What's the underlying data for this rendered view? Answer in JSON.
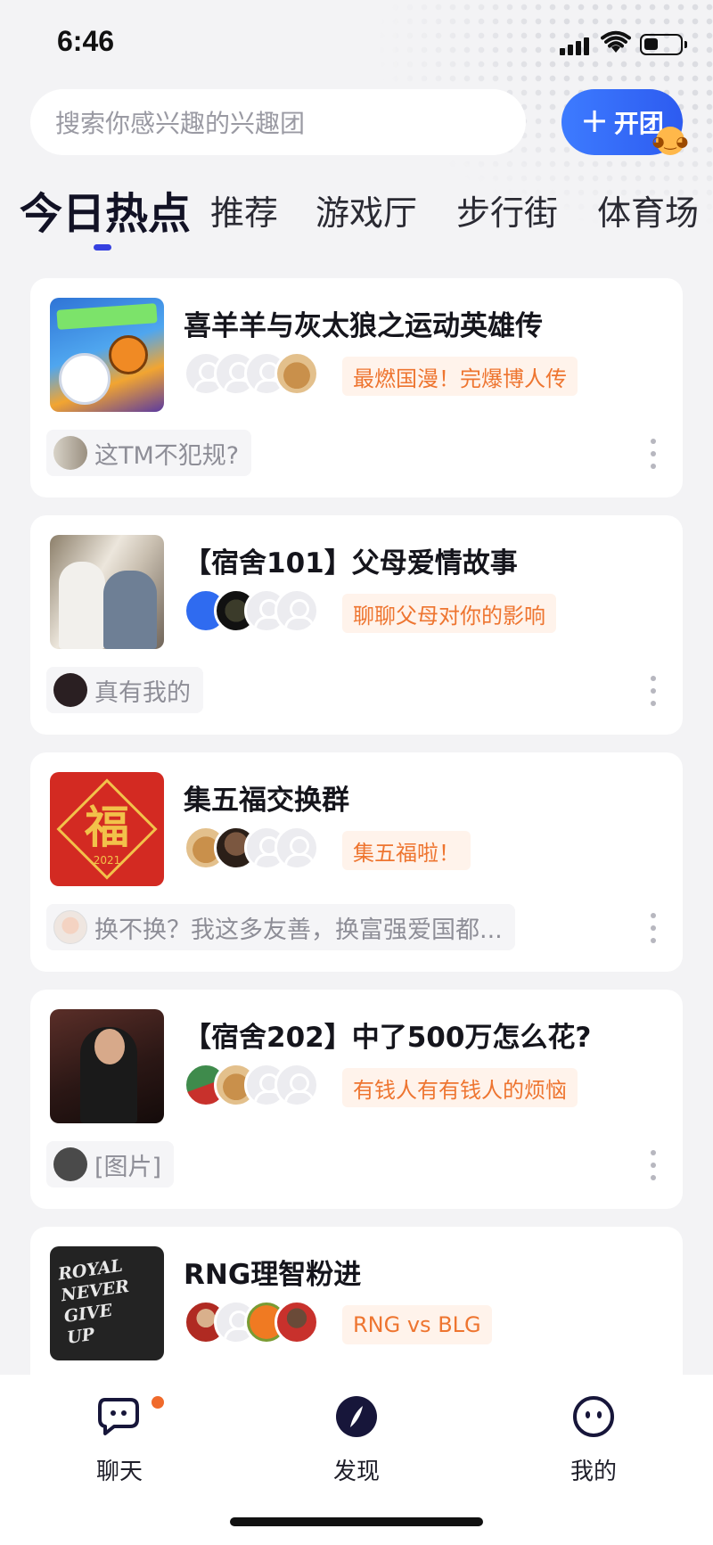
{
  "status_bar": {
    "time": "6:46"
  },
  "search": {
    "placeholder": "搜索你感兴趣的兴趣团"
  },
  "open_button": {
    "label": "开团",
    "icon": "plus-icon"
  },
  "tabs": [
    {
      "label": "今日热点",
      "active": true
    },
    {
      "label": "推荐",
      "active": false
    },
    {
      "label": "游戏厅",
      "active": false
    },
    {
      "label": "步行街",
      "active": false
    },
    {
      "label": "体育场",
      "active": false
    }
  ],
  "groups": [
    {
      "title": "喜羊羊与灰太狼之运动英雄传",
      "tag": "最燃国漫！完爆博人传",
      "last_message": "这TM不犯规?"
    },
    {
      "title": "【宿舍101】父母爱情故事",
      "tag": "聊聊父母对你的影响",
      "last_message": "真有我的"
    },
    {
      "title": "集五福交换群",
      "tag": "集五福啦！",
      "last_message": "换不换？我这多友善，换富强爱国都..."
    },
    {
      "title": "【宿舍202】中了500万怎么花?",
      "tag": "有钱人有有钱人的烦恼",
      "last_message": "[图片]"
    },
    {
      "title": "RNG理智粉进",
      "tag": "RNG vs BLG",
      "last_message": ""
    }
  ],
  "thumb_art": {
    "fu_char": "福",
    "fu_year": "2021",
    "royal_text": [
      "ROYAL",
      "NEVER",
      "GIVE",
      "UP"
    ]
  },
  "bottom_nav": [
    {
      "label": "聊天",
      "icon": "chat-bubbles-icon",
      "has_badge": true
    },
    {
      "label": "发现",
      "icon": "compass-icon",
      "has_badge": false
    },
    {
      "label": "我的",
      "icon": "smiley-profile-icon",
      "has_badge": false
    }
  ],
  "colors": {
    "accent": "#3540e0",
    "button": "#2d5bf0",
    "tag_text": "#ee7530",
    "tag_bg": "#fff3eb",
    "badge": "#f06a2b"
  }
}
